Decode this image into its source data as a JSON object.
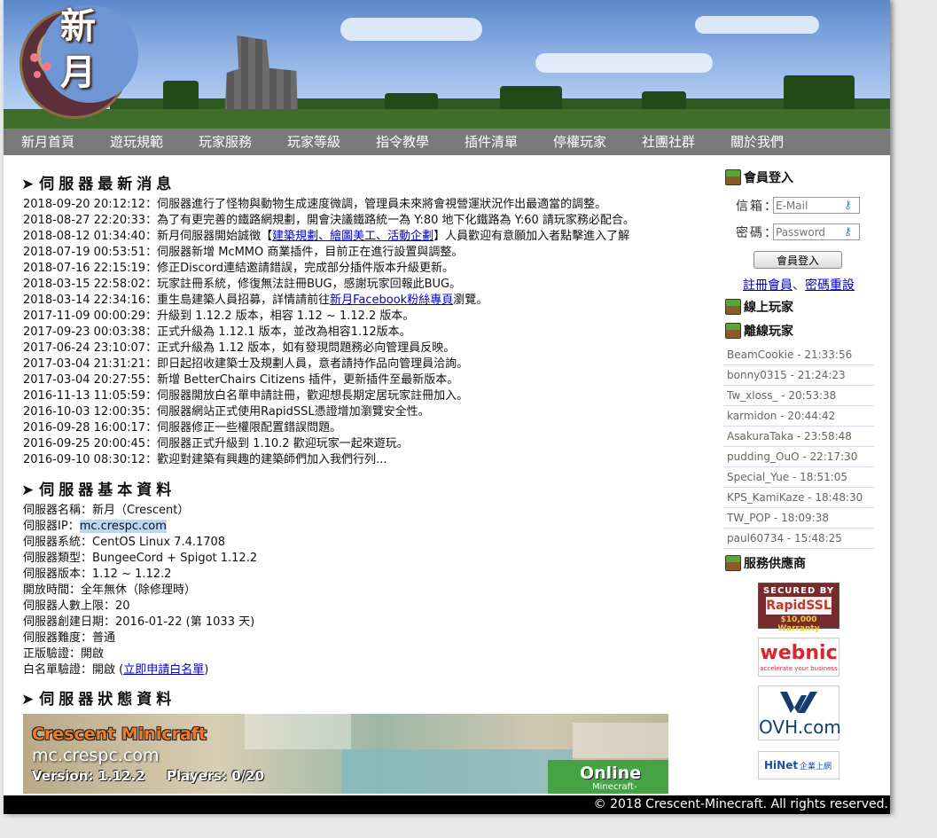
{
  "logo": {
    "text": "新月"
  },
  "nav": [
    "新月首頁",
    "遊玩規範",
    "玩家服務",
    "玩家等級",
    "指令教學",
    "插件清單",
    "停權玩家",
    "社團社群",
    "關於我們"
  ],
  "news": {
    "title": "伺服器最新消息",
    "items": [
      {
        "date": "2018-09-20 20:12:12",
        "text": "伺服器進行了怪物與動物生成速度微調，管理員未來將會視營運狀況作出最適當的調整。"
      },
      {
        "date": "2018-08-27 22:20:33",
        "text": "為了有更完善的鐵路網規劃，開會決議鐵路統一為 Y:80 地下化鐵路為 Y:60 請玩家務必配合。"
      },
      {
        "date": "2018-08-12 01:34:40",
        "before": "新月伺服器開始誠徵【",
        "link": "建築規劃、繪圖美工、活動企劃",
        "after": "】人員歡迎有意願加入者點擊進入了解"
      },
      {
        "date": "2018-07-19 00:53:51",
        "text": "伺服器新增 McMMO 商業插件，目前正在進行設置與調整。"
      },
      {
        "date": "2018-07-16 22:15:19",
        "text": "修正Discord連結邀請錯誤，完成部分插件版本升級更新。"
      },
      {
        "date": "2018-03-15 22:58:02",
        "text": "玩家註冊系統，修復無法註冊BUG，感謝玩家回報此BUG。"
      },
      {
        "date": "2018-03-14 22:34:16",
        "before": "重生島建築人員招募，詳情請前往",
        "link": "新月Facebook粉絲專頁",
        "after": "瀏覽。"
      },
      {
        "date": "2017-11-09 00:00:29",
        "text": "升級到 1.12.2 版本，相容 1.12 ~ 1.12.2 版本。"
      },
      {
        "date": "2017-09-23 00:03:38",
        "text": "正式升級為 1.12.1 版本，並改為相容1.12版本。"
      },
      {
        "date": "2017-06-24 23:10:07",
        "text": "正式升級為 1.12 版本，如有發現問題務必向管理員反映。"
      },
      {
        "date": "2017-03-04 21:31:21",
        "text": "即日起招收建築士及規劃人員，意者請持作品向管理員洽詢。"
      },
      {
        "date": "2017-03-04 20:27:55",
        "text": "新增 BetterChairs Citizens 插件，更新插件至最新版本。"
      },
      {
        "date": "2016-11-13 11:05:59",
        "text": "伺服器開放白名單申請註冊，歡迎想長期定居玩家註冊加入。"
      },
      {
        "date": "2016-10-03 12:00:35",
        "text": "伺服器網站正式使用RapidSSL憑證增加瀏覽安全性。"
      },
      {
        "date": "2016-09-28 16:00:17",
        "text": "伺服器修正一些權限配置錯誤問題。"
      },
      {
        "date": "2016-09-25 20:00:45",
        "text": "伺服器正式升級到 1.10.2 歡迎玩家一起來遊玩。"
      },
      {
        "date": "2016-09-10 08:30:12",
        "text": "歡迎對建築有興趣的建築師們加入我們行列..."
      }
    ]
  },
  "info": {
    "title": "伺服器基本資料",
    "name": "伺服器名稱：新月（Crescent）",
    "ip_label": "伺服器IP：",
    "ip": "mc.crespc.com",
    "system": "伺服器系統：CentOS Linux 7.4.1708",
    "type": "伺服器類型：BungeeCord + Spigot 1.12.2",
    "version": "伺服器版本：1.12 ~ 1.12.2",
    "hours": "開放時間：全年無休（除修理時）",
    "max_players": "伺服器人數上限：20",
    "created": "伺服器創建日期：2016-01-22 (第 1033 天)",
    "difficulty": "伺服器難度：普通",
    "auth": "正版驗證：開啟",
    "whitelist_label": "白名單驗證：開啟 (",
    "whitelist_link": "立即申請白名單",
    "whitelist_close": ")"
  },
  "status": {
    "title": "伺服器狀態資料",
    "banner_title": "Crescent Minicraft",
    "host": "mc.crespc.com",
    "version": "Version: 1.12.2",
    "players": "Players: 0/20",
    "online": "Online",
    "brand": "Minecraft-mp.com"
  },
  "sidebar": {
    "login_title": "會員登入",
    "email_label": "信箱：",
    "email_placeholder": "E-Mail",
    "password_label": "密碼：",
    "password_placeholder": "Password",
    "login_button": "會員登入",
    "register_link": "註冊會員",
    "separator": "、",
    "reset_link": "密碼重設",
    "online_title": "線上玩家",
    "offline_title": "離線玩家",
    "offline_players": [
      "BeamCookie - 21:33:56",
      "bonny0315 - 21:24:23",
      "Tw_xloss_ - 20:53:38",
      "karmidon - 20:44:42",
      "AsakuraTaka - 23:58:48",
      "pudding_OuO - 22:17:30",
      "Special_Yue - 18:51:05",
      "KPS_KamiKaze - 18:48:30",
      "TW_POP - 18:09:38",
      "paul60734 - 15:48:25"
    ],
    "sponsor_title": "服務供應商",
    "sponsors": {
      "rapidssl_top": "SECURED BY",
      "rapidssl_name": "RapidSSL",
      "rapidssl_warranty": "$10,000 Warranty",
      "webnic_name": "webnic",
      "webnic_tag": "accelerate your business",
      "ovh_name": "OVH.com",
      "hinet_name": "HiNet",
      "hinet_tag": "企業上網"
    }
  },
  "footer": "© 2018 Crescent-Minecraft. All rights reserved.",
  "colors": {
    "nav_bg": "#7a7a7a",
    "footer_bg": "#000000",
    "link": "#0000cc",
    "online_green": "#44a344"
  }
}
